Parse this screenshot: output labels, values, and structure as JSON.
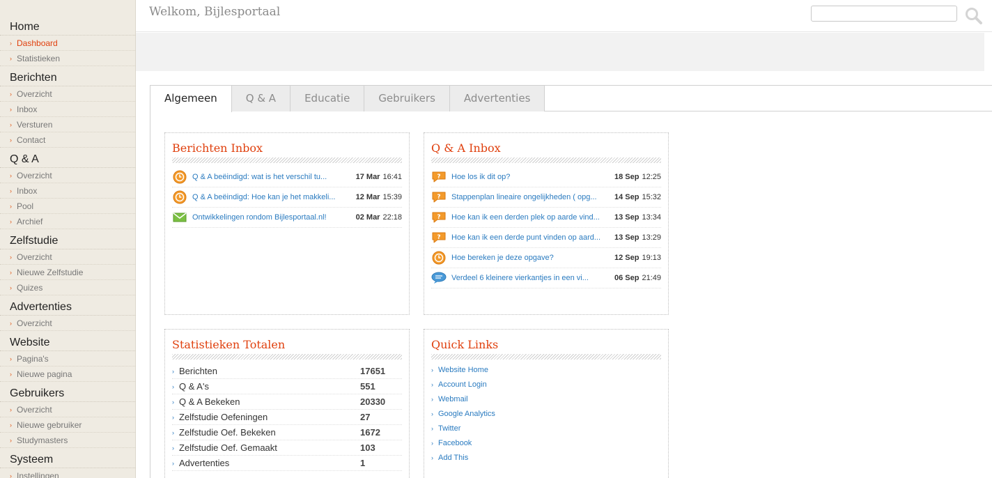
{
  "header": {
    "welcome": "Welkom, Bijlesportaal",
    "search_placeholder": ""
  },
  "sidebar": {
    "sections": [
      {
        "title": "Home",
        "items": [
          "Dashboard",
          "Statistieken"
        ]
      },
      {
        "title": "Berichten",
        "items": [
          "Overzicht",
          "Inbox",
          "Versturen",
          "Contact"
        ]
      },
      {
        "title": "Q & A",
        "items": [
          "Overzicht",
          "Inbox",
          "Pool",
          "Archief"
        ]
      },
      {
        "title": "Zelfstudie",
        "items": [
          "Overzicht",
          "Nieuwe Zelfstudie",
          "Quizes"
        ]
      },
      {
        "title": "Advertenties",
        "items": [
          "Overzicht"
        ]
      },
      {
        "title": "Website",
        "items": [
          "Pagina's",
          "Nieuwe pagina"
        ]
      },
      {
        "title": "Gebruikers",
        "items": [
          "Overzicht",
          "Nieuwe gebruiker",
          "Studymasters"
        ]
      },
      {
        "title": "Systeem",
        "items": [
          "Instellingen"
        ]
      }
    ],
    "active": "Dashboard"
  },
  "tabs": [
    "Algemeen",
    "Q & A",
    "Educatie",
    "Gebruikers",
    "Advertenties"
  ],
  "active_tab": "Algemeen",
  "berichten_inbox": {
    "title": "Berichten Inbox",
    "rows": [
      {
        "icon": "clock-icon",
        "title": "Q & A beëindigd: wat is het verschil tu...",
        "date": "17 Mar",
        "time": "16:41"
      },
      {
        "icon": "clock-icon",
        "title": "Q & A beëindigd: Hoe kan je het makkeli...",
        "date": "12 Mar",
        "time": "15:39"
      },
      {
        "icon": "envelope-icon",
        "title": "Ontwikkelingen rondom Bijlesportaal.nl!",
        "date": "02 Mar",
        "time": "22:18"
      }
    ]
  },
  "qa_inbox": {
    "title": "Q & A Inbox",
    "rows": [
      {
        "icon": "question-bubble-icon",
        "title": "Hoe los ik dit op?",
        "date": "18 Sep",
        "time": "12:25"
      },
      {
        "icon": "question-bubble-icon",
        "title": "Stappenplan lineaire ongelijkheden ( opg...",
        "date": "14 Sep",
        "time": "15:32"
      },
      {
        "icon": "question-bubble-icon",
        "title": "Hoe kan ik een derden plek op aarde vind...",
        "date": "13 Sep",
        "time": "13:34"
      },
      {
        "icon": "question-bubble-icon",
        "title": "Hoe kan ik een derde punt vinden op aard...",
        "date": "13 Sep",
        "time": "13:29"
      },
      {
        "icon": "clock-icon",
        "title": "Hoe bereken je deze opgave?",
        "date": "12 Sep",
        "time": "19:13"
      },
      {
        "icon": "chat-bubble-icon",
        "title": "Verdeel 6 kleinere vierkantjes in een vi...",
        "date": "06 Sep",
        "time": "21:49"
      }
    ]
  },
  "statistieken": {
    "title": "Statistieken Totalen",
    "rows": [
      {
        "label": "Berichten",
        "value": "17651"
      },
      {
        "label": "Q & A's",
        "value": "551"
      },
      {
        "label": "Q & A Bekeken",
        "value": "20330"
      },
      {
        "label": "Zelfstudie Oefeningen",
        "value": "27"
      },
      {
        "label": "Zelfstudie Oef. Bekeken",
        "value": "1672"
      },
      {
        "label": "Zelfstudie Oef. Gemaakt",
        "value": "103"
      },
      {
        "label": "Advertenties",
        "value": "1"
      }
    ]
  },
  "quick_links": {
    "title": "Quick Links",
    "items": [
      "Website Home",
      "Account Login",
      "Webmail",
      "Google Analytics",
      "Twitter",
      "Facebook",
      "Add This"
    ]
  },
  "colors": {
    "accent": "#e0400e",
    "link": "#2a7bc0",
    "icon_orange": "#f39a2b"
  }
}
